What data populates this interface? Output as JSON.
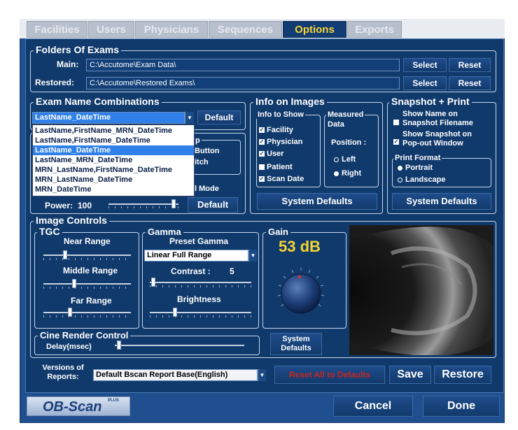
{
  "tabs": [
    "Facilities",
    "Users",
    "Physicians",
    "Sequences",
    "Options",
    "Exports"
  ],
  "active_tab": "Options",
  "folders": {
    "title": "Folders Of Exams",
    "main_label": "Main:",
    "main_value": "C:\\Accutome\\Exam Data\\",
    "restored_label": "Restored:",
    "restored_value": "C:\\Accutome\\Restored Exams\\",
    "select_label": "Select",
    "reset_label": "Reset"
  },
  "exam_name": {
    "title": "Exam Name Combinations",
    "selected": "LastName_DateTime",
    "default_label": "Default",
    "options": [
      "LastName,FirstName_MRN_DateTime",
      "LastName,FirstName_DateTime",
      "LastName_DateTime",
      "LastName_MRN_DateTime",
      "MRN_LastName,FirstName_DateTime",
      "MRN_LastName_DateTime",
      "MRN_DateTime"
    ],
    "highlighted_index": 2
  },
  "hidden_panel": {
    "frag_title": "p",
    "frag_1": "Button",
    "frag_2": "itch",
    "frag_3": "l Mode",
    "power_label": "Power:",
    "power_value": "100",
    "default_label": "Default"
  },
  "info": {
    "title": "Info on Images",
    "show_title": "Info to Show",
    "items": [
      {
        "label": "Facility",
        "checked": true
      },
      {
        "label": "Physician",
        "checked": true
      },
      {
        "label": "User",
        "checked": true
      },
      {
        "label": "Patient",
        "checked": false
      },
      {
        "label": "Scan Date",
        "checked": true
      }
    ],
    "measured_title_1": "Measured",
    "measured_title_2": "Data",
    "position_label": "Position :",
    "left_label": "Left",
    "right_label": "Right",
    "position_value": "Right",
    "defaults_label": "System Defaults"
  },
  "snapshot": {
    "title": "Snapshot + Print",
    "opt1_line1": "Show Name on",
    "opt1_line2": "Snapshot Filename",
    "opt1_checked": false,
    "opt2_line1": "Show Snapshot on",
    "opt2_line2": "Pop-out Window",
    "opt2_checked": true,
    "print_title": "Print Format",
    "portrait_label": "Portrait",
    "landscape_label": "Landscape",
    "print_value": "Portrait",
    "defaults_label": "System Defaults"
  },
  "image_controls": {
    "title": "Image Controls",
    "tgc_title": "TGC",
    "near_label": "Near Range",
    "near_value": 0.25,
    "middle_label": "Middle Range",
    "middle_value": 0.35,
    "far_label": "Far Range",
    "far_value": 0.3,
    "gamma_title": "Gamma",
    "preset_label": "Preset Gamma",
    "preset_value": "Linear Full Range",
    "contrast_label": "Contrast :",
    "contrast_value": "5",
    "brightness_label": "Brightness",
    "brightness_value": 0.25,
    "gain_title": "Gain",
    "gain_value": "53 dB",
    "gain_defaults_line1": "System",
    "gain_defaults_line2": "Defaults",
    "cine_title": "Cine Render Control",
    "delay_label": "Delay(msec)",
    "delay_value": 0.03
  },
  "versions": {
    "label_line1": "Versions of",
    "label_line2": "Reports:",
    "value": "Default Bscan Report Base(English)"
  },
  "bottom": {
    "reset_all": "Reset All to Defaults",
    "save": "Save",
    "restore": "Restore",
    "cancel": "Cancel",
    "done": "Done"
  },
  "logo": {
    "text": "OB-Scan",
    "small": "PLUS"
  },
  "colors": {
    "accent_yellow": "#f6d432",
    "panel_blue": "#113a6c",
    "highlight": "#2f80e8",
    "reset_red": "#c8261e"
  }
}
